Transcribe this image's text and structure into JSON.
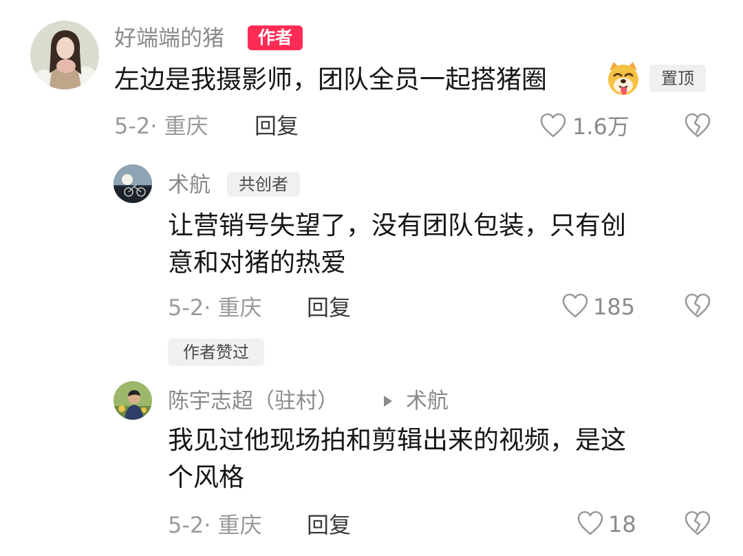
{
  "comments": [
    {
      "user": "好端端的猪",
      "tag": "作者",
      "text": "左边是我摄影师，团队全员一起搭猪圈",
      "emoji": "dog-face-tongue-out",
      "pinned_label": "置顶",
      "date_location": "5-2· 重庆",
      "reply_label": "回复",
      "likes": "1.6万"
    }
  ],
  "replies": [
    {
      "user": "术航",
      "tag": "共创者",
      "text_line1": "让营销号失望了，没有团队包装，只有创",
      "text_line2": "意和对猪的热爱",
      "date_location": "5-2· 重庆",
      "reply_label": "回复",
      "likes": "185",
      "author_liked_label": "作者赞过"
    },
    {
      "user": "陈宇志超（驻村）",
      "reply_to": "术航",
      "text_line1": "我见过他现场拍和剪辑出来的视频，是这",
      "text_line2": "个风格",
      "date_location": "5-2· 重庆",
      "reply_label": "回复",
      "likes": "18"
    }
  ],
  "colors": {
    "author_tag_bg": "#fe2c55",
    "tag_gray_bg": "#f0f0f0",
    "secondary_text": "#8a8a8a",
    "primary_text": "#161616"
  },
  "icons": [
    "heart-icon",
    "dislike-broken-heart-icon",
    "play-arrow-icon"
  ]
}
